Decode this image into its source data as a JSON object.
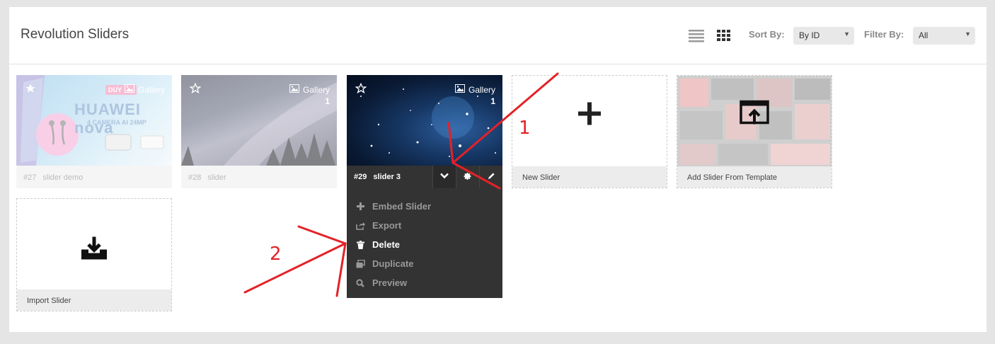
{
  "header": {
    "title": "Revolution Sliders",
    "sort_label": "Sort By:",
    "sort_value": "By ID",
    "filter_label": "Filter By:",
    "filter_value": "All"
  },
  "sliders": [
    {
      "id": "#27",
      "name": "slider demo",
      "type": "Gallery",
      "count": ""
    },
    {
      "id": "#28",
      "name": "slider",
      "type": "Gallery",
      "count": "1"
    },
    {
      "id": "#29",
      "name": "slider 3",
      "type": "Gallery",
      "count": "1"
    }
  ],
  "thumb27_text": {
    "brand": "HUAWEI nova",
    "sub": "4 CAMERA AI 24MP",
    "badge": "DUY"
  },
  "menu": [
    {
      "label": "Embed Slider",
      "icon": "plus-icon"
    },
    {
      "label": "Export",
      "icon": "export-icon"
    },
    {
      "label": "Delete",
      "icon": "trash-icon"
    },
    {
      "label": "Duplicate",
      "icon": "duplicate-icon"
    },
    {
      "label": "Preview",
      "icon": "search-icon"
    }
  ],
  "actions": {
    "new_slider": "New Slider",
    "add_template": "Add Slider From Template",
    "import_slider": "Import Slider"
  },
  "annotations": {
    "n1": "1",
    "n2": "2",
    "color": "#e32227"
  },
  "colors": {
    "dark_panel": "#333333",
    "background": "#e5e5e5"
  }
}
